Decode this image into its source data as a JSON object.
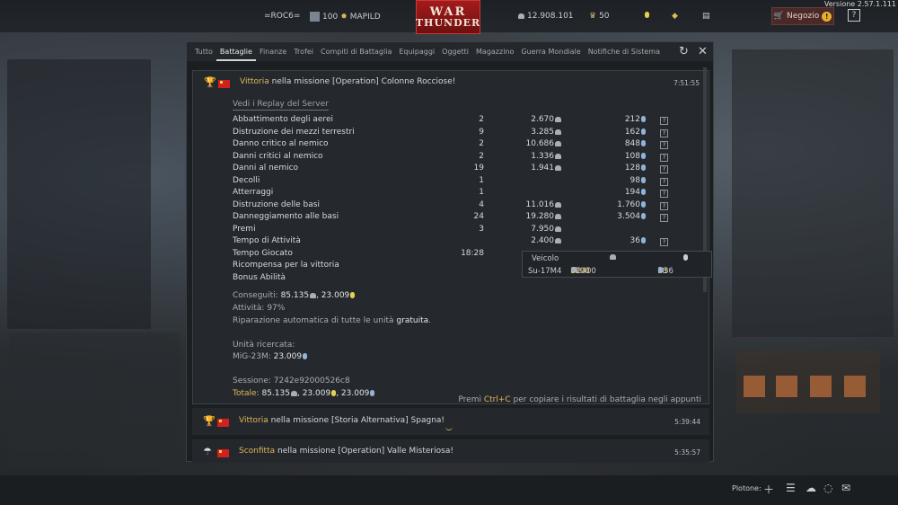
{
  "app": {
    "version": "Versione 2.57.1.111"
  },
  "topbar": {
    "player": "=ROC6=",
    "level": "100",
    "name": "MAPILD",
    "logo_line1": "WAR",
    "logo_line2": "THUNDER",
    "silver_lions": "12.908.101",
    "golden_eagles": "50",
    "shop_label": "Negozio",
    "help_label": "?"
  },
  "tabs": [
    {
      "label": "Tutto"
    },
    {
      "label": "Battaglie"
    },
    {
      "label": "Finanze"
    },
    {
      "label": "Trofei"
    },
    {
      "label": "Compiti di Battaglia"
    },
    {
      "label": "Equipaggi"
    },
    {
      "label": "Oggetti"
    },
    {
      "label": "Magazzino"
    },
    {
      "label": "Guerra Mondiale"
    },
    {
      "label": "Notifiche di Sistema"
    }
  ],
  "messages": [
    {
      "result": "Vittoria",
      "text": " nella missione [Operation] Colonne Rocciose!",
      "time": "7:51:55",
      "icon": "trophy-icon"
    },
    {
      "result": "Vittoria",
      "text": " nella missione [Storia Alternativa] Spagna!",
      "time": "5:39:44",
      "icon": "trophy-icon"
    },
    {
      "result": "Sconfitta",
      "text": " nella missione [Operation] Valle Misteriosa!",
      "time": "5:35:57",
      "icon": "parachute-icon"
    }
  ],
  "report": {
    "replay_link": "Vedi i Replay del Server",
    "rows": [
      {
        "name": "Abbattimento degli aerei",
        "count": "2",
        "sl": "2.670",
        "rp": "212"
      },
      {
        "name": "Distruzione dei mezzi terrestri",
        "count": "9",
        "sl": "3.285",
        "rp": "162"
      },
      {
        "name": "Danno critico al nemico",
        "count": "2",
        "sl": "10.686",
        "rp": "848"
      },
      {
        "name": "Danni critici al nemico",
        "count": "2",
        "sl": "1.336",
        "rp": "108"
      },
      {
        "name": "Danni al nemico",
        "count": "19",
        "sl": "1.941",
        "rp": "128"
      },
      {
        "name": "Decolli",
        "count": "1",
        "sl": "",
        "rp": "98"
      },
      {
        "name": "Atterraggi",
        "count": "1",
        "sl": "",
        "rp": "194"
      },
      {
        "name": "Distruzione delle basi",
        "count": "4",
        "sl": "11.016",
        "rp": "1.760"
      },
      {
        "name": "Danneggiamento alle basi",
        "count": "24",
        "sl": "19.280",
        "rp": "3.504"
      },
      {
        "name": "Premi",
        "count": "3",
        "sl": "7.950",
        "rp": ""
      },
      {
        "name": "Tempo di Attività",
        "count": "",
        "sl": "2.400",
        "rp": "36"
      },
      {
        "name": "Tempo Giocato",
        "count": "18:28",
        "sl": "",
        "rp": ""
      },
      {
        "name": "Ricompensa per la vittoria",
        "count": "",
        "sl": "24.571",
        "rp": ""
      },
      {
        "name": "Bonus Abilità",
        "count": "",
        "sl": "",
        "rp": ""
      }
    ],
    "earned_label": "Conseguiti: ",
    "earned_sl": "85.135",
    "earned_rp": "23.009",
    "activity": "Attività: 97%",
    "repair_prefix": "Riparazione automatica di tutte le unità ",
    "repair_value": "gratuita",
    "repair_suffix": ".",
    "researched_label": "Unità ricercata:",
    "researched_unit": "MiG-23M: ",
    "researched_rp": "23.009",
    "session": "Sessione: 7242e92000526c8",
    "total_label": "Totale: ",
    "total_sl": "85.135",
    "total_gold": "23.009",
    "total_rp": "23.009",
    "hint_prefix": "Premi ",
    "hint_key": "Ctrl+C",
    "hint_suffix": " per copiare i risultati di battaglia negli appunti"
  },
  "tooltip": {
    "header_vehicle": "Veicolo",
    "vehicle": "Su-17M4",
    "sl_base": "1200",
    "sl_bonus": "1200",
    "sl_total": "=2400",
    "rp_base": "18",
    "rp_bonus": "18",
    "rp_total": "=36"
  },
  "bottombar": {
    "platoon_label": "Plotone:"
  }
}
